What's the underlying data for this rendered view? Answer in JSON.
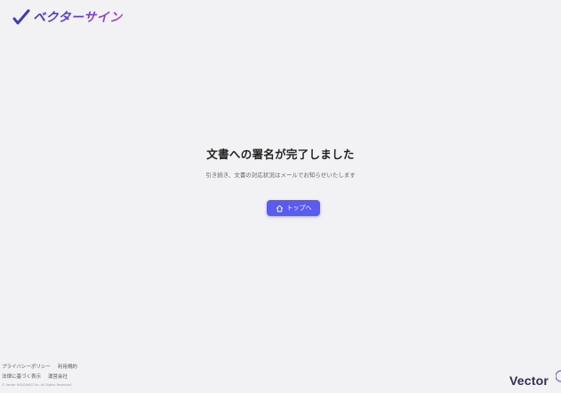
{
  "header": {
    "logo_text": "ベクターサイン"
  },
  "main": {
    "heading": "文書への署名が完了しました",
    "subtext": "引き続き、文書の対応状況はメールでお知らせいたします",
    "top_button_label": "トップへ"
  },
  "footer": {
    "links": [
      "プライバシーポリシー",
      "利用規約",
      "法律に基づく表示",
      "運営会社"
    ],
    "copyright": "© Vector HOLDINGS Inc. All Rights Reserved."
  },
  "brand": {
    "text": "Vector"
  },
  "colors": {
    "accent": "#5a5cf0",
    "background": "#f2f2f4"
  }
}
